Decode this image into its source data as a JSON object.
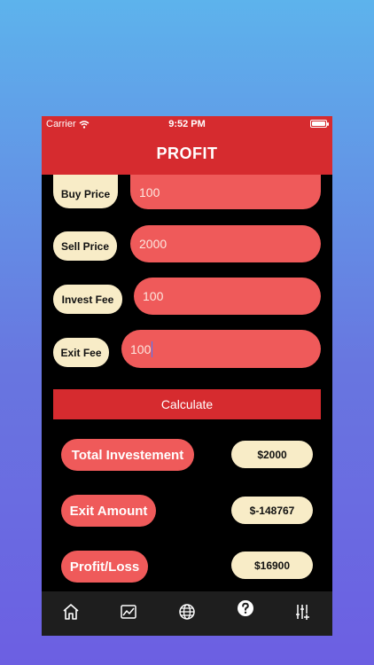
{
  "status": {
    "carrier": "Carrier",
    "time": "9:52 PM"
  },
  "nav": {
    "title": "PROFIT"
  },
  "form": {
    "buy_price": {
      "label": "Buy Price",
      "value": "100"
    },
    "sell_price": {
      "label": "Sell Price",
      "value": "2000"
    },
    "invest_fee": {
      "label": "Invest Fee",
      "value": "100"
    },
    "exit_fee": {
      "label": "Exit Fee",
      "value": "100"
    }
  },
  "calculate_label": "Calculate",
  "results": {
    "total_investment": {
      "label": "Total Investement",
      "value": "$2000"
    },
    "exit_amount": {
      "label": "Exit Amount",
      "value": "$-148767"
    },
    "profit_loss": {
      "label": "Profit/Loss",
      "value": "$16900"
    }
  },
  "tabs": [
    {
      "icon": "home-icon"
    },
    {
      "icon": "chart-icon"
    },
    {
      "icon": "globe-icon"
    },
    {
      "icon": "help-icon"
    },
    {
      "icon": "sliders-icon"
    }
  ],
  "colors": {
    "accent": "#d62b2f",
    "pill_red": "#ef5a5a",
    "pill_cream": "#f8ecc7",
    "tabbar": "#1e1e1e"
  }
}
